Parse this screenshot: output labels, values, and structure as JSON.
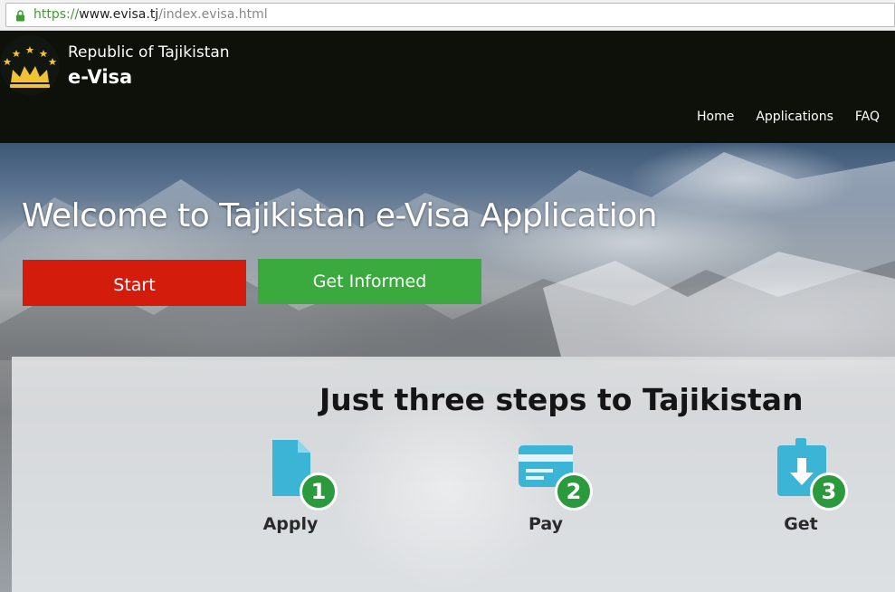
{
  "browser": {
    "url_scheme": "https://",
    "url_host": "www.evisa.tj",
    "url_path": "/index.evisa.html"
  },
  "header": {
    "brand_subtitle": "Republic of Tajikistan",
    "brand_title": "e-Visa",
    "nav": [
      {
        "label": "Home"
      },
      {
        "label": "Applications"
      },
      {
        "label": "FAQ"
      }
    ]
  },
  "hero": {
    "title": "Welcome to Tajikistan e-Visa Application",
    "start_label": "Start",
    "info_label": "Get Informed"
  },
  "steps": {
    "title": "Just three steps to Tajikistan",
    "items": [
      {
        "number": "1",
        "label": "Apply",
        "icon": "document-icon"
      },
      {
        "number": "2",
        "label": "Pay",
        "icon": "credit-card-icon"
      },
      {
        "number": "3",
        "label": "Get",
        "icon": "download-badge-icon"
      }
    ]
  },
  "colors": {
    "start": "#d41c0d",
    "info": "#3aaa3e",
    "step_icon": "#3cb4d6",
    "step_number": "#2b9a3c",
    "header_bg": "#0d110a"
  }
}
